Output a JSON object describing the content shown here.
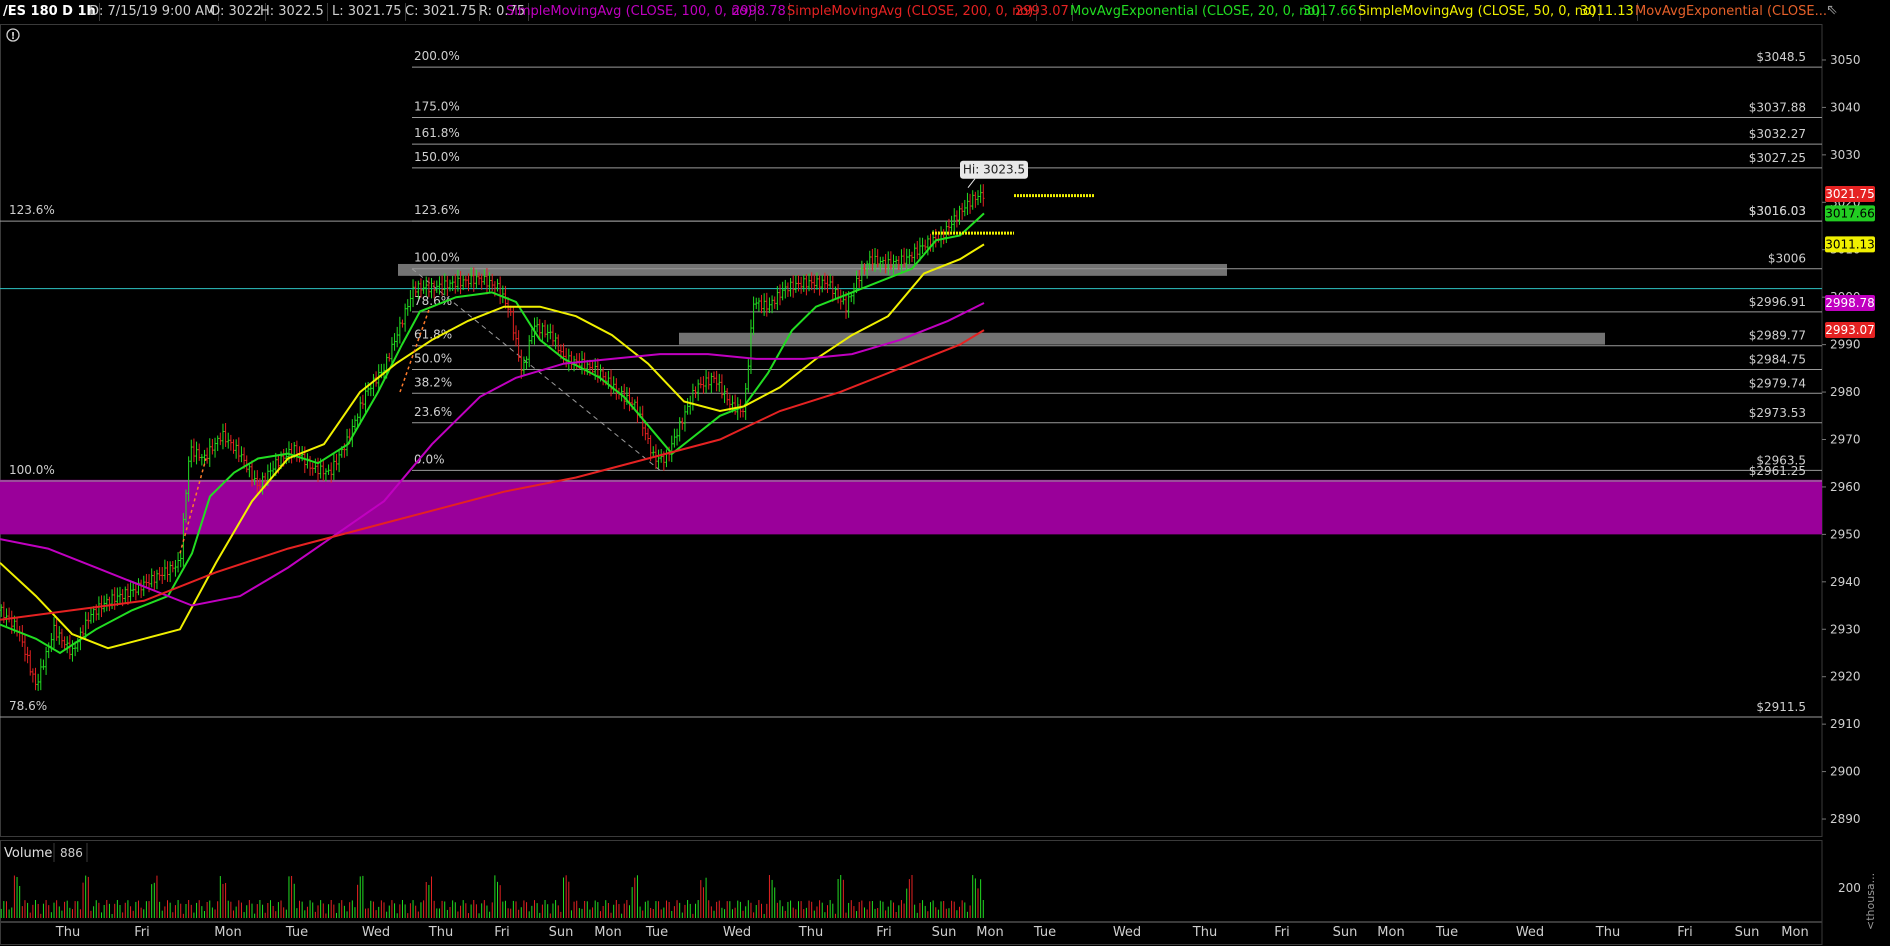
{
  "header": {
    "symbol": "/ES 180 D 1h",
    "date": "D: 7/15/19 9:00 AM",
    "open": "O: 3022",
    "high": "H: 3022.5",
    "low": "L: 3021.75",
    "close": "C: 3021.75",
    "range": "R: 0.75",
    "studies": [
      {
        "label": "SimpleMovingAvg (CLOSE, 100, 0, no)",
        "value": "2998.78",
        "color": "#c000c0"
      },
      {
        "label": "SimpleMovingAvg (CLOSE, 200, 0, no)",
        "value": "2993.07",
        "color": "#e52222"
      },
      {
        "label": "MovAvgExponential (CLOSE, 20, 0, no)",
        "value": "3017.66",
        "color": "#22dd22"
      },
      {
        "label": "SimpleMovingAvg (CLOSE, 50, 0, no)",
        "value": "3011.13",
        "color": "#f0f000"
      },
      {
        "label": "MovAvgExponential (CLOSE...",
        "value": "",
        "color": "#e5602a"
      }
    ]
  },
  "chart_data": {
    "type": "line",
    "price_axis": {
      "ticks": [
        3050,
        3040,
        3030,
        3020,
        3010,
        3000,
        2990,
        2980,
        2970,
        2960,
        2950,
        2940,
        2930,
        2920,
        2910,
        2900,
        2890
      ],
      "ylim": [
        2886,
        3054
      ]
    },
    "x_axis_labels": [
      "Thu",
      "Fri",
      "Mon",
      "Tue",
      "Wed",
      "Thu",
      "Fri",
      "Sun",
      "Mon",
      "Tue",
      "Wed",
      "Thu",
      "Fri",
      "Sun",
      "Mon",
      "Tue",
      "Wed",
      "Thu",
      "Fri",
      "Sun",
      "Mon",
      "Tue",
      "Wed",
      "Thu",
      "Fri",
      "Sun",
      "Mon"
    ],
    "hi_callout": "Hi: 3023.5",
    "fib_right": [
      {
        "label": "200.0%",
        "price": 3048.5,
        "text": "$3048.5"
      },
      {
        "label": "175.0%",
        "price": 3037.88,
        "text": "$3037.88"
      },
      {
        "label": "161.8%",
        "price": 3032.27,
        "text": "$3032.27"
      },
      {
        "label": "150.0%",
        "price": 3027.25,
        "text": "$3027.25"
      },
      {
        "label": "123.6%",
        "price": 3016.03,
        "text": "$3016.03"
      },
      {
        "label": "100.0%",
        "price": 3006,
        "text": "$3006"
      },
      {
        "label": "78.6%",
        "price": 2996.91,
        "text": "$2996.91"
      },
      {
        "label": "61.8%",
        "price": 2989.77,
        "text": "$2989.77"
      },
      {
        "label": "50.0%",
        "price": 2984.75,
        "text": "$2984.75"
      },
      {
        "label": "38.2%",
        "price": 2979.74,
        "text": "$2979.74"
      },
      {
        "label": "23.6%",
        "price": 2973.53,
        "text": "$2973.53"
      },
      {
        "label": "0.0%",
        "price": 2963.5,
        "text": "$2963.5"
      }
    ],
    "fib_left": [
      {
        "label": "123.6%",
        "price": 3016.03,
        "text": "$3016.03"
      },
      {
        "label": "100.0%",
        "price": 2961.25,
        "text": "$2961.25"
      },
      {
        "label": "78.6%",
        "price": 2911.5,
        "text": "$2911.5"
      }
    ],
    "last_price_tags": [
      {
        "value": "3021.75",
        "price": 3021.75,
        "bg": "#e52222",
        "fg": "#ffffff"
      },
      {
        "value": "3017.66",
        "price": 3017.66,
        "bg": "#22cc22",
        "fg": "#000000"
      },
      {
        "value": "3011.13",
        "price": 3011.13,
        "bg": "#f0f000",
        "fg": "#000000"
      },
      {
        "value": "2998.78",
        "price": 2998.78,
        "bg": "#c000c0",
        "fg": "#ffffff"
      },
      {
        "value": "2993.07",
        "price": 2993.07,
        "bg": "#e52222",
        "fg": "#ffffff"
      }
    ],
    "zones": [
      {
        "name": "resistance zone",
        "price_top": 3007,
        "price_bottom": 3004.5,
        "color": "#9a9a9a"
      },
      {
        "name": "support zone",
        "price_top": 2992.5,
        "price_bottom": 2990,
        "color": "#9a9a9a"
      },
      {
        "name": "demand zone",
        "price_top": 2961.5,
        "price_bottom": 2950,
        "color": "#9a009a"
      }
    ],
    "horizontal_lines": [
      {
        "price": 3001.8,
        "color": "#2ec4c4"
      }
    ],
    "series": [
      {
        "name": "MovAvgExponential (CLOSE, 20, 0, no)",
        "color": "#22dd22",
        "points": [
          [
            0,
            2931
          ],
          [
            30,
            2928
          ],
          [
            50,
            2925
          ],
          [
            80,
            2930
          ],
          [
            110,
            2934
          ],
          [
            140,
            2937
          ],
          [
            160,
            2946
          ],
          [
            175,
            2958
          ],
          [
            195,
            2963
          ],
          [
            215,
            2966
          ],
          [
            240,
            2967
          ],
          [
            265,
            2965
          ],
          [
            290,
            2969
          ],
          [
            315,
            2980
          ],
          [
            335,
            2990
          ],
          [
            350,
            2997
          ],
          [
            380,
            3000
          ],
          [
            410,
            3001
          ],
          [
            430,
            2999
          ],
          [
            450,
            2991
          ],
          [
            470,
            2987
          ],
          [
            500,
            2983
          ],
          [
            520,
            2979
          ],
          [
            540,
            2973
          ],
          [
            560,
            2967
          ],
          [
            575,
            2970
          ],
          [
            600,
            2975
          ],
          [
            620,
            2977
          ],
          [
            640,
            2984
          ],
          [
            660,
            2993
          ],
          [
            680,
            2998
          ],
          [
            700,
            3000
          ],
          [
            720,
            3002
          ],
          [
            740,
            3004
          ],
          [
            760,
            3006
          ],
          [
            780,
            3012
          ],
          [
            800,
            3013
          ],
          [
            820,
            3017.66
          ]
        ]
      },
      {
        "name": "SimpleMovingAvg (CLOSE, 50, 0, no)",
        "color": "#f0f000",
        "points": [
          [
            0,
            2944
          ],
          [
            30,
            2937
          ],
          [
            60,
            2929
          ],
          [
            90,
            2926
          ],
          [
            120,
            2928
          ],
          [
            150,
            2930
          ],
          [
            180,
            2944
          ],
          [
            210,
            2957
          ],
          [
            240,
            2966
          ],
          [
            270,
            2969
          ],
          [
            300,
            2980
          ],
          [
            330,
            2986
          ],
          [
            360,
            2991
          ],
          [
            390,
            2995
          ],
          [
            420,
            2998
          ],
          [
            450,
            2998
          ],
          [
            480,
            2996
          ],
          [
            510,
            2992
          ],
          [
            540,
            2986
          ],
          [
            570,
            2978
          ],
          [
            600,
            2976
          ],
          [
            620,
            2977
          ],
          [
            650,
            2981
          ],
          [
            680,
            2987
          ],
          [
            710,
            2992
          ],
          [
            740,
            2996
          ],
          [
            770,
            3005
          ],
          [
            800,
            3008
          ],
          [
            820,
            3011.13
          ]
        ]
      },
      {
        "name": "SimpleMovingAvg (CLOSE, 100, 0, no)",
        "color": "#c000c0",
        "points": [
          [
            0,
            2949
          ],
          [
            40,
            2947
          ],
          [
            80,
            2943
          ],
          [
            120,
            2939
          ],
          [
            160,
            2935
          ],
          [
            200,
            2937
          ],
          [
            240,
            2943
          ],
          [
            280,
            2950
          ],
          [
            320,
            2957
          ],
          [
            360,
            2969
          ],
          [
            400,
            2979
          ],
          [
            430,
            2983
          ],
          [
            470,
            2986
          ],
          [
            510,
            2987
          ],
          [
            550,
            2988
          ],
          [
            590,
            2988
          ],
          [
            630,
            2987
          ],
          [
            670,
            2987
          ],
          [
            710,
            2988
          ],
          [
            750,
            2991
          ],
          [
            790,
            2995
          ],
          [
            820,
            2998.78
          ]
        ]
      },
      {
        "name": "SimpleMovingAvg (CLOSE, 200, 0, no)",
        "color": "#e52222",
        "points": [
          [
            0,
            2932
          ],
          [
            60,
            2934
          ],
          [
            120,
            2936
          ],
          [
            180,
            2942
          ],
          [
            240,
            2947
          ],
          [
            300,
            2951
          ],
          [
            360,
            2955
          ],
          [
            420,
            2959
          ],
          [
            480,
            2962
          ],
          [
            540,
            2966
          ],
          [
            600,
            2970
          ],
          [
            650,
            2976
          ],
          [
            700,
            2980
          ],
          [
            750,
            2985
          ],
          [
            800,
            2990
          ],
          [
            820,
            2993.07
          ]
        ]
      }
    ],
    "price_path": [
      [
        0,
        2934
      ],
      [
        15,
        2930
      ],
      [
        30,
        2918
      ],
      [
        45,
        2930
      ],
      [
        60,
        2925
      ],
      [
        75,
        2933
      ],
      [
        90,
        2936
      ],
      [
        110,
        2938
      ],
      [
        130,
        2941
      ],
      [
        150,
        2944
      ],
      [
        158,
        2968
      ],
      [
        170,
        2966
      ],
      [
        185,
        2971
      ],
      [
        200,
        2967
      ],
      [
        215,
        2960
      ],
      [
        230,
        2965
      ],
      [
        245,
        2968
      ],
      [
        260,
        2964
      ],
      [
        275,
        2963
      ],
      [
        290,
        2970
      ],
      [
        305,
        2980
      ],
      [
        320,
        2985
      ],
      [
        335,
        2995
      ],
      [
        345,
        3002
      ],
      [
        360,
        3002
      ],
      [
        380,
        3003
      ],
      [
        400,
        3004
      ],
      [
        415,
        3002
      ],
      [
        425,
        2997
      ],
      [
        435,
        2984
      ],
      [
        445,
        2994
      ],
      [
        460,
        2992
      ],
      [
        470,
        2987
      ],
      [
        485,
        2986
      ],
      [
        500,
        2984
      ],
      [
        515,
        2980
      ],
      [
        530,
        2977
      ],
      [
        545,
        2966
      ],
      [
        555,
        2966
      ],
      [
        565,
        2972
      ],
      [
        580,
        2981
      ],
      [
        595,
        2983
      ],
      [
        610,
        2977
      ],
      [
        620,
        2976
      ],
      [
        628,
        2999
      ],
      [
        640,
        2998
      ],
      [
        655,
        3002
      ],
      [
        670,
        3003
      ],
      [
        690,
        3003
      ],
      [
        705,
        2998
      ],
      [
        715,
        3004
      ],
      [
        725,
        3008
      ],
      [
        740,
        3007
      ],
      [
        755,
        3008
      ],
      [
        770,
        3011
      ],
      [
        785,
        3013
      ],
      [
        800,
        3018
      ],
      [
        812,
        3021
      ],
      [
        820,
        3021.75
      ]
    ],
    "volume": {
      "label": "Volume",
      "value": "886",
      "tick": "200",
      "unit_label": "<thousa..."
    }
  }
}
